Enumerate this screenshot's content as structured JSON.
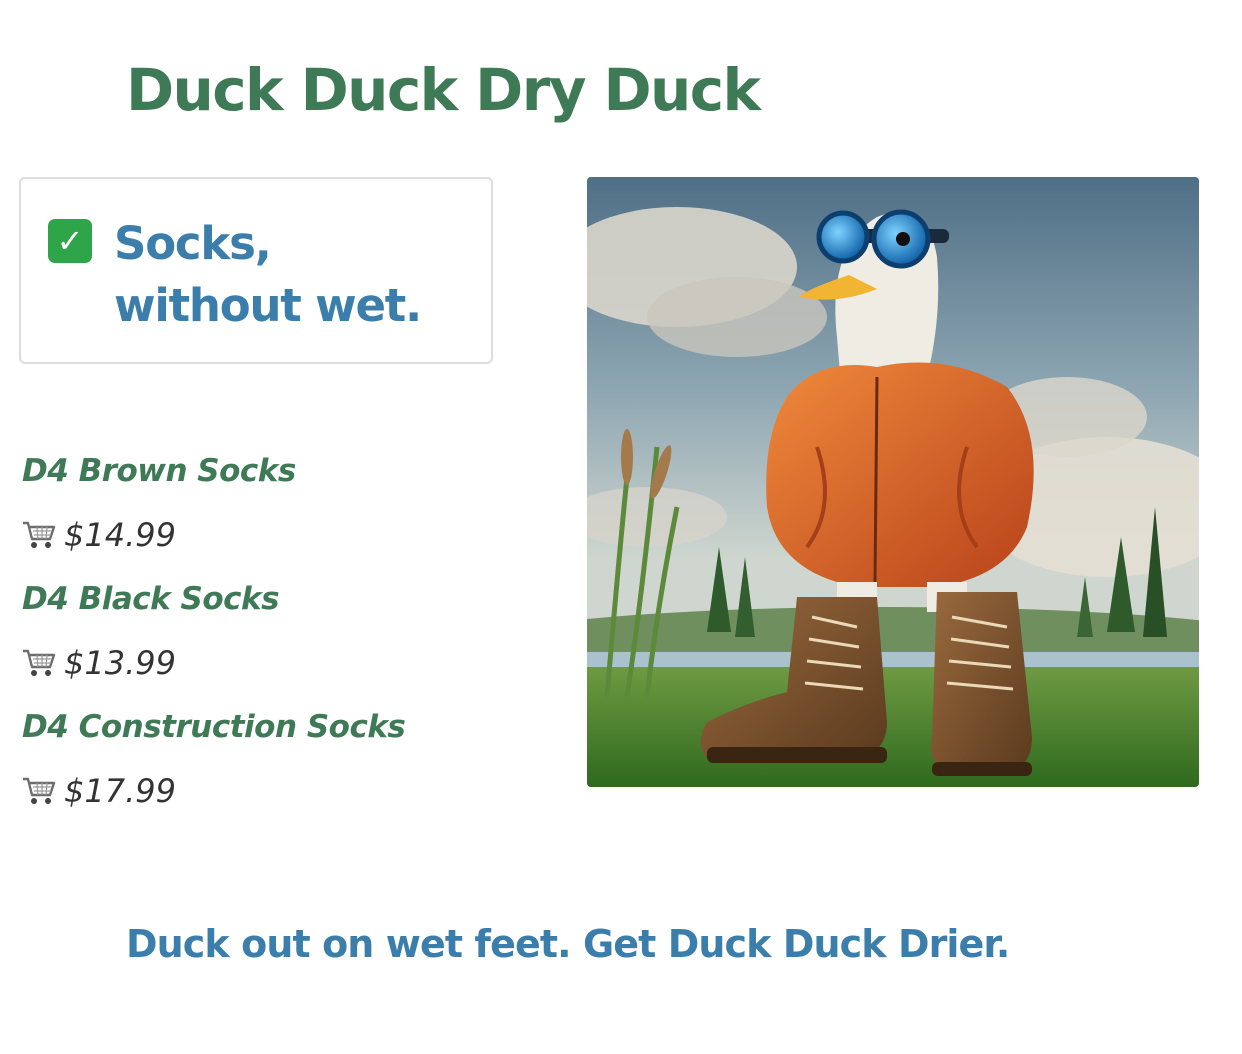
{
  "header": {
    "title": "Duck Duck Dry Duck"
  },
  "callout": {
    "icon": "check-mark-button-icon",
    "text": "Socks, without wet."
  },
  "products": [
    {
      "name": "D4 Brown Socks",
      "price": "$14.99",
      "icon": "shopping-cart-icon"
    },
    {
      "name": "D4 Black Socks",
      "price": "$13.99",
      "icon": "shopping-cart-icon"
    },
    {
      "name": "D4 Construction Socks",
      "price": "$17.99",
      "icon": "shopping-cart-icon"
    }
  ],
  "hero": {
    "subject": "duck-in-goggles-jacket-and-boots"
  },
  "footer": {
    "tagline": "Duck out on wet feet. Get Duck Duck Drier."
  },
  "colors": {
    "green": "#3f7a56",
    "blue": "#3b7eab",
    "price_text": "#333333",
    "border": "#dddddd"
  }
}
